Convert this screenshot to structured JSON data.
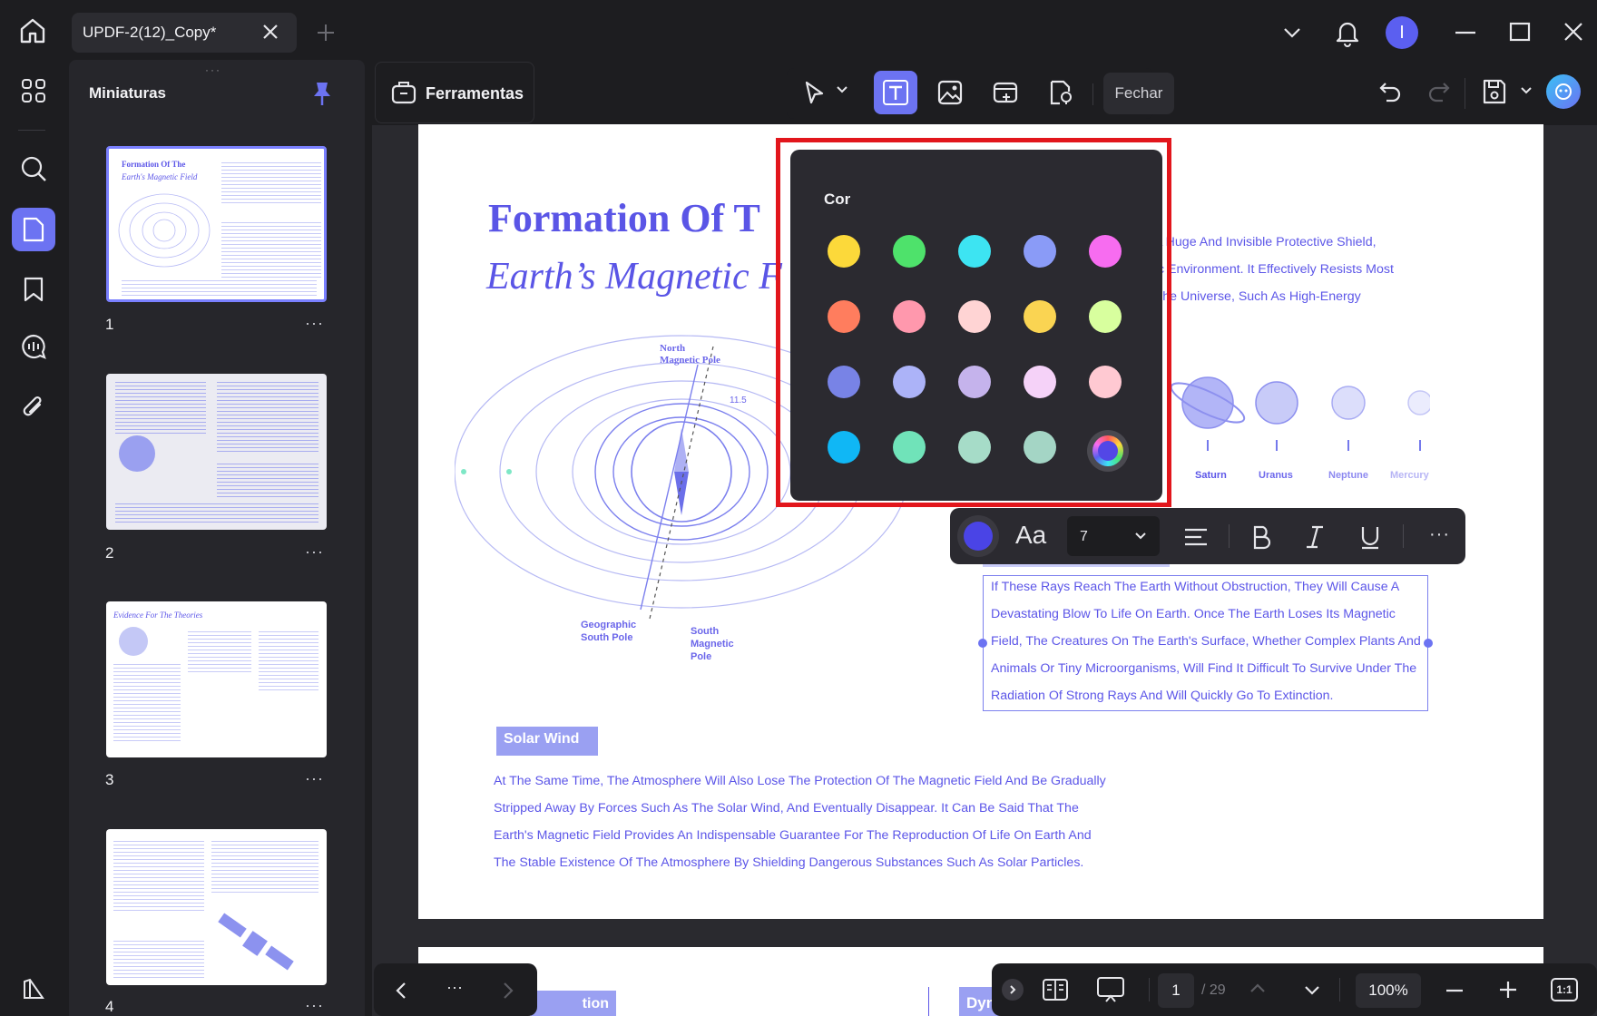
{
  "titlebar": {
    "tab_title": "UPDF-2(12)_Copy*",
    "avatar_letter": "I"
  },
  "thumbnails": {
    "title": "Miniaturas",
    "pages": [
      {
        "num": "1",
        "more": "···",
        "heading1": "Formation Of The",
        "heading2": "Earth's Magnetic Field"
      },
      {
        "num": "2",
        "more": "···"
      },
      {
        "num": "3",
        "more": "···",
        "heading1": "Evidence For The Theories"
      },
      {
        "num": "4",
        "more": "···"
      }
    ]
  },
  "toolbar": {
    "tools_label": "Ferramentas",
    "close_label": "Fechar"
  },
  "popup": {
    "title": "Cor",
    "swatches": [
      "#fcd93a",
      "#4ee26b",
      "#3de4f2",
      "#8a9bf7",
      "#f76cf0",
      "#ff7d5e",
      "#ff98ad",
      "#ffd4d4",
      "#fad452",
      "#d8ff9e",
      "#7883e6",
      "#acb3f8",
      "#c5b3ec",
      "#f5d2f8",
      "#ffc9d2",
      "#10b7f5",
      "#70e3b9",
      "#a6dcc8",
      "#a4d5c5"
    ],
    "current_color": "#4a44e6"
  },
  "format_bar": {
    "font_icon_label": "Aa",
    "font_size": "7"
  },
  "document": {
    "title_line1": "Formation Of T",
    "title_line2": "Earth’s Magnetic F",
    "right_para": [
      "e A Huge And Invisible Protective Shield,",
      "mic Environment. It Effectively Resists Most",
      "n The Universe, Such As High-Energy"
    ],
    "planets": [
      "Saturn",
      "Uranus",
      "Neptune",
      "Mercury"
    ],
    "diagram_labels": {
      "north": "North",
      "north_pole": "Magnetic Pole",
      "angle": "11.5",
      "geo_south1": "Geographic",
      "geo_south2": "South Pole",
      "south1": "South",
      "south2": "Magnetic",
      "south3": "Pole"
    },
    "box_lines": [
      "If These Rays Reach The Earth Without Obstruction, They Will Cause A",
      "Devastating Blow To Life On Earth. Once The Earth Loses Its Magnetic",
      "Field, The Creatures On The Earth's Surface, Whether Complex Plants And",
      "Animals Or Tiny Microorganisms, Will Find It Difficult To Survive Under The",
      "Radiation Of Strong Rays And Will Quickly Go To Extinction."
    ],
    "solar_wind_heading": "Solar Wind",
    "solar_lines": [
      "At The Same Time, The Atmosphere Will Also Lose The Protection Of The Magnetic Field And Be Gradually",
      "Stripped Away By Forces Such As The Solar Wind, And Eventually Disappear. It Can Be Said That The",
      "Earth's Magnetic Field Provides An Indispensable Guarantee For The Reproduction Of Life On Earth And",
      "The Stable Existence Of The Atmosphere By Shielding Dangerous Substances Such As Solar Particles."
    ],
    "page2_left": "tion",
    "page2_right": "Dyn"
  },
  "bottom": {
    "page_current": "1",
    "page_total": "/ 29",
    "zoom": "100%",
    "fit_label": "1:1",
    "more": "···"
  }
}
